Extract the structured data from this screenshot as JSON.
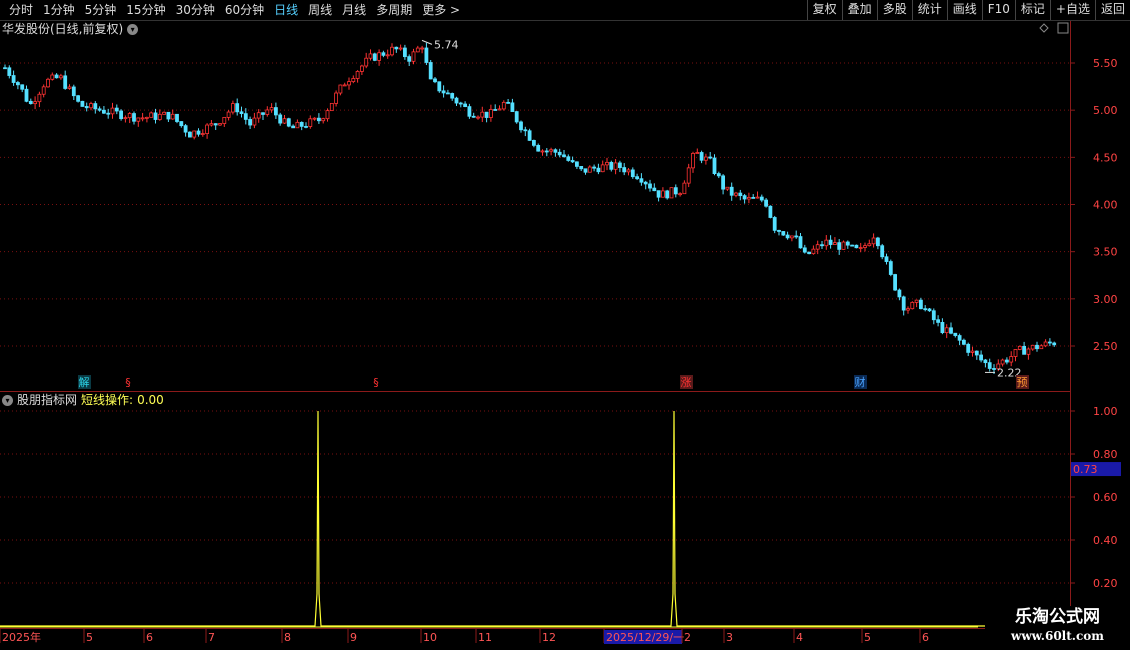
{
  "toolbar": {
    "periods": [
      "分时",
      "1分钟",
      "5分钟",
      "15分钟",
      "30分钟",
      "60分钟",
      "日线",
      "周线",
      "月线",
      "多周期",
      "更多 >"
    ],
    "active": "日线",
    "right": [
      "复权",
      "叠加",
      "多股",
      "统计",
      "画线",
      "F10",
      "标记",
      "+自选",
      "返回"
    ]
  },
  "stock": {
    "title": "华发股份(日线,前复权)",
    "high_label": "5.74",
    "low_label": "2.22"
  },
  "price_axis": [
    "5.50",
    "5.00",
    "4.50",
    "4.00",
    "3.50",
    "3.00",
    "2.50"
  ],
  "markers": [
    {
      "text": "解",
      "color": "#2bd3e6"
    },
    {
      "text": "§",
      "color": "#ff3333"
    },
    {
      "text": "§",
      "color": "#ff3333"
    },
    {
      "text": "涨",
      "color": "#ff3333"
    },
    {
      "text": "财",
      "color": "#4aa3ff"
    },
    {
      "text": "预",
      "color": "#ff9933"
    }
  ],
  "indicator": {
    "name": "股朋指标网",
    "series_label": "短线操作:",
    "series_value": "0.00",
    "axis": [
      "1.00",
      "0.80",
      "0.60",
      "0.40",
      "0.20"
    ],
    "cursor_value": "0.73",
    "spikes": [
      {
        "x_date": "2025-08 (late)",
        "value": 1.0
      },
      {
        "x_date": "2026-01-29",
        "value": 1.0
      }
    ]
  },
  "date_axis": [
    "2025年",
    "5",
    "6",
    "7",
    "8",
    "9",
    "10",
    "11",
    "12",
    "2025/12/29/一",
    "2",
    "3",
    "4",
    "5",
    "6"
  ],
  "watermark": {
    "line1": "乐淘公式网",
    "line2": "www.60lt.com"
  },
  "colors": {
    "up": "#ff3333",
    "down": "#55e0ff",
    "grid": "#7a1010",
    "indicator": "#ffff33"
  }
}
